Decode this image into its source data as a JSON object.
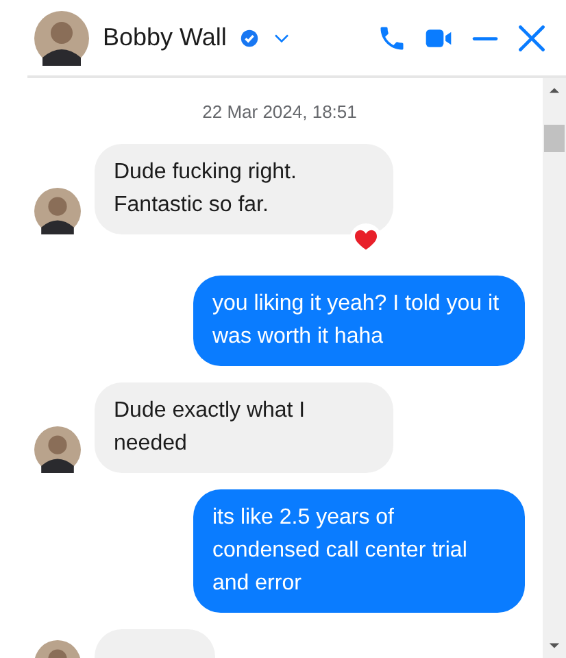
{
  "header": {
    "name": "Bobby Wall",
    "verified": true
  },
  "timestamp": "22 Mar 2024, 18:51",
  "messages": [
    {
      "kind": "incoming",
      "text": "Dude fucking right. Fantastic so far.",
      "reaction": true
    },
    {
      "kind": "outgoing",
      "text": "you liking it yeah? I told you it was worth it haha",
      "reaction": false
    },
    {
      "kind": "incoming",
      "text": "Dude exactly what I needed",
      "reaction": false
    },
    {
      "kind": "outgoing",
      "text": "its like 2.5 years of condensed call center trial and error",
      "reaction": false
    },
    {
      "kind": "partial"
    }
  ]
}
